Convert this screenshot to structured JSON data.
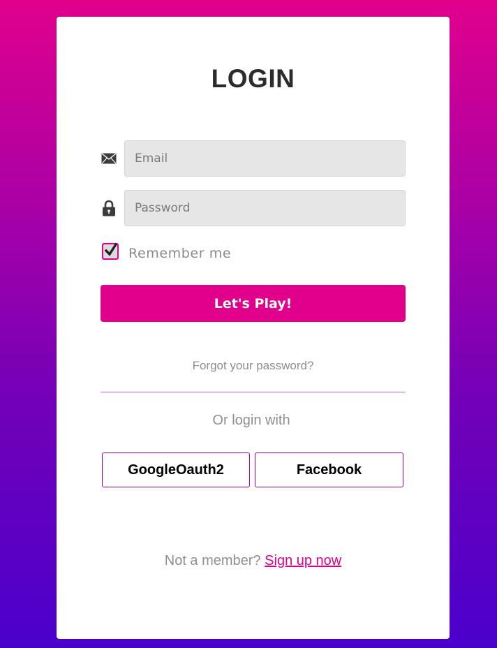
{
  "login": {
    "title": "LOGIN",
    "email": {
      "placeholder": "Email",
      "value": "",
      "icon": "envelope-icon"
    },
    "password": {
      "placeholder": "Password",
      "value": "",
      "icon": "lock-icon"
    },
    "remember": {
      "label": "Remember me",
      "checked": true
    },
    "submit_label": "Let's Play!",
    "forgot_label": "Forgot your password?",
    "or_label": "Or login with",
    "social": [
      {
        "label": "GoogleOauth2"
      },
      {
        "label": "Facebook"
      }
    ],
    "footer": {
      "prompt": "Not a member?",
      "signup_label": "Sign up now"
    }
  },
  "colors": {
    "accent": "#e1008c",
    "gradient_top": "#e1008c",
    "gradient_bottom": "#4a00cc"
  }
}
